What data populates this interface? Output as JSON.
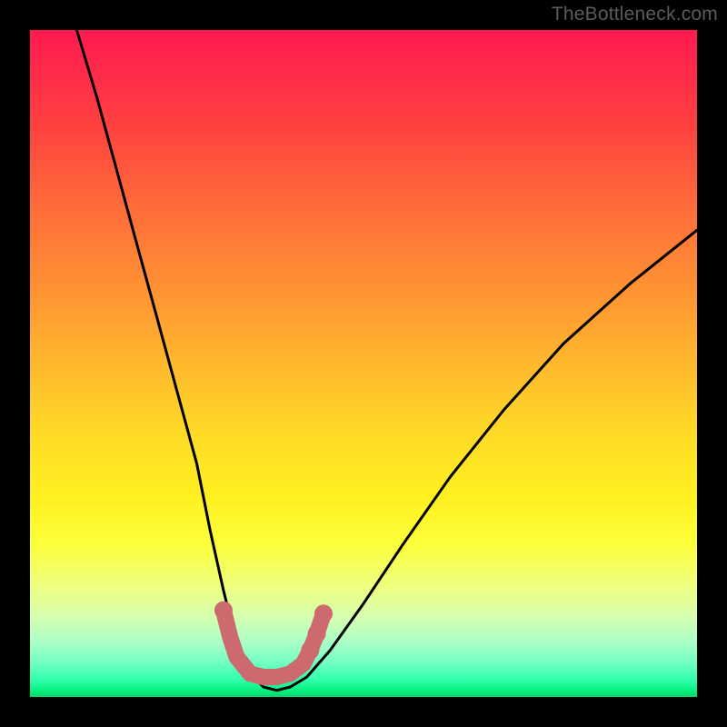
{
  "watermark": "TheBottleneck.com",
  "chart_data": {
    "type": "line",
    "title": "",
    "xlabel": "",
    "ylabel": "",
    "xlim": [
      0,
      100
    ],
    "ylim": [
      0,
      100
    ],
    "series": [
      {
        "name": "bottleneck-curve",
        "x": [
          7,
          10,
          13,
          16,
          19,
          22,
          25,
          27,
          29,
          30.5,
          32,
          33.5,
          35,
          37,
          39,
          41.5,
          45,
          50,
          56,
          63,
          71,
          80,
          90,
          100
        ],
        "values": [
          100,
          90,
          79,
          68,
          57,
          46,
          35,
          25,
          16,
          10,
          6,
          3,
          1.5,
          1,
          1.5,
          3,
          7,
          14,
          23,
          33,
          43,
          53,
          62,
          70
        ]
      }
    ],
    "highlight_band": {
      "name": "optimal-zone",
      "x": [
        29,
        30,
        31,
        33,
        35,
        37,
        39,
        41,
        42,
        43,
        44
      ],
      "values": [
        13,
        9,
        6,
        3.5,
        3,
        3,
        3.5,
        5,
        7,
        9.5,
        12.5
      ]
    },
    "gradient_stops": [
      {
        "pos": 0,
        "color": "#ff1a50"
      },
      {
        "pos": 20,
        "color": "#ff5a3e"
      },
      {
        "pos": 40,
        "color": "#ff9a30"
      },
      {
        "pos": 60,
        "color": "#ffdd26"
      },
      {
        "pos": 80,
        "color": "#f2ff60"
      },
      {
        "pos": 92,
        "color": "#a0ffc0"
      },
      {
        "pos": 100,
        "color": "#06d66d"
      }
    ]
  }
}
